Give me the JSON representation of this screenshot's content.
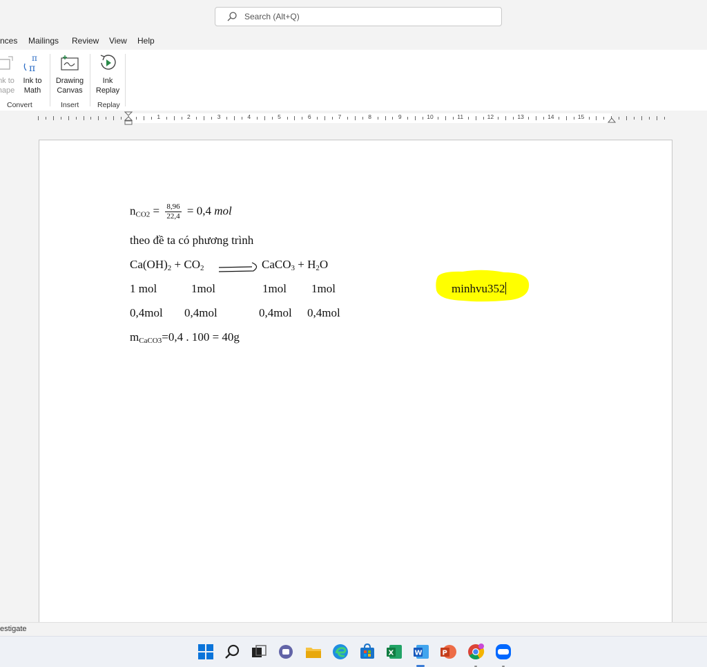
{
  "search": {
    "placeholder": "Search (Alt+Q)"
  },
  "tabs": [
    "nces",
    "Mailings",
    "Review",
    "View",
    "Help"
  ],
  "ribbon": {
    "buttons": {
      "ink_to_shape": [
        "nk to",
        "hape"
      ],
      "ink_to_math": [
        "Ink to",
        "Math"
      ],
      "drawing_canvas": [
        "Drawing",
        "Canvas"
      ],
      "ink_replay": [
        "Ink",
        "Replay"
      ]
    },
    "groups": {
      "convert": "Convert",
      "insert": "Insert",
      "replay": "Replay"
    }
  },
  "ruler": {
    "numbers": [
      "1",
      "2",
      "3",
      "4",
      "5",
      "6",
      "7",
      "8",
      "9",
      "10",
      "11",
      "12",
      "13",
      "14",
      "15"
    ]
  },
  "document": {
    "line1": {
      "n": "n",
      "n_sub": "CO2",
      "eq": "=",
      "num": "8,96",
      "den": "22,4",
      "result": "= 0,4",
      "unit": "mol"
    },
    "line2": "theo đề ta có phương trình",
    "line3": {
      "lhs": "Ca(OH)",
      "lhs_sub": "2",
      "lhs_rest": " + CO",
      "lhs_sub2": "2",
      "rhs": "CaCO",
      "rhs_sub": "3",
      "rhs_rest": " + H",
      "rhs_sub2": "2",
      "rhs_end": "O"
    },
    "row_mol": [
      "1 mol",
      "1mol",
      "1mol",
      "1mol"
    ],
    "row_04": [
      "0,4mol",
      "0,4mol",
      "0,4mol",
      "0,4mol"
    ],
    "line6": {
      "m": "m",
      "m_sub": "CaCO3",
      "rest": "=0,4 . 100 = 40g"
    },
    "user_tag": "minhvu352"
  },
  "status": {
    "left_text": "estigate"
  },
  "colors": {
    "highlight": "#ffff00",
    "accent": "#3a7bd5"
  },
  "taskbar": [
    "windows-start-icon",
    "search-icon",
    "task-view-icon",
    "teams-chat-icon",
    "file-explorer-icon",
    "edge-icon",
    "store-icon",
    "excel-icon",
    "word-icon",
    "powerpoint-icon",
    "chrome-icon",
    "zalo-icon"
  ]
}
